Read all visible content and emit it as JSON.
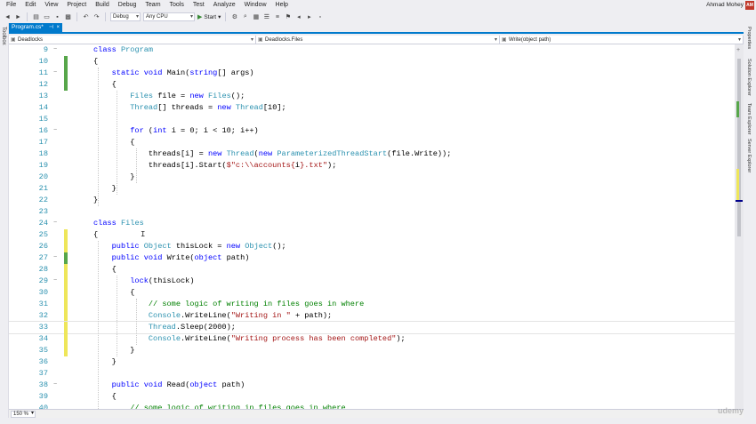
{
  "menu": [
    "File",
    "Edit",
    "View",
    "Project",
    "Build",
    "Debug",
    "Team",
    "Tools",
    "Test",
    "Analyze",
    "Window",
    "Help"
  ],
  "user": {
    "name": "Ahmad Mohey",
    "initials": "AM"
  },
  "toolbar": {
    "configuration": "Debug",
    "platform": "Any CPU",
    "start_label": "Start"
  },
  "left_tool": "Toolbox",
  "right_tabs": [
    "Properties",
    "Solution Explorer",
    "Team Explorer",
    "Server Explorer"
  ],
  "document_tab": {
    "title": "Program.cs*",
    "pin": "⊣",
    "close": "×"
  },
  "navbar": {
    "project": "Deadlocks",
    "class": "Deadlocks.Files",
    "member": "Write(object path)"
  },
  "zoom": "150 %",
  "code_lines": [
    {
      "num": "9",
      "change": "none",
      "html": "<span class=\"kw\">class</span> <span class=\"ty\">Program</span>"
    },
    {
      "num": "10",
      "change": "green",
      "html": "{"
    },
    {
      "num": "11",
      "change": "green",
      "html": "    <span class=\"kw\">static</span> <span class=\"kw\">void</span> Main(<span class=\"kw\">string</span>[] args)"
    },
    {
      "num": "12",
      "change": "green",
      "html": "    {"
    },
    {
      "num": "13",
      "change": "none",
      "html": "        <span class=\"ty\">Files</span> file = <span class=\"kw\">new</span> <span class=\"ty\">Files</span>();"
    },
    {
      "num": "14",
      "change": "none",
      "html": "        <span class=\"ty\">Thread</span>[] threads = <span class=\"kw\">new</span> <span class=\"ty\">Thread</span>[10];"
    },
    {
      "num": "15",
      "change": "none",
      "html": ""
    },
    {
      "num": "16",
      "change": "none",
      "html": "        <span class=\"kw\">for</span> (<span class=\"kw\">int</span> i = 0; i &lt; 10; i++)"
    },
    {
      "num": "17",
      "change": "none",
      "html": "        {"
    },
    {
      "num": "18",
      "change": "none",
      "html": "            threads[i] = <span class=\"kw\">new</span> <span class=\"ty\">Thread</span>(<span class=\"kw\">new</span> <span class=\"ty\">ParameterizedThreadStart</span>(file.Write));"
    },
    {
      "num": "19",
      "change": "none",
      "html": "            threads[i].Start(<span class=\"st\">$\"c:\\\\accounts{</span>i<span class=\"st\">}.txt\"</span>);"
    },
    {
      "num": "20",
      "change": "none",
      "html": "        }"
    },
    {
      "num": "21",
      "change": "none",
      "html": "    }"
    },
    {
      "num": "22",
      "change": "none",
      "html": "}"
    },
    {
      "num": "23",
      "change": "none",
      "html": ""
    },
    {
      "num": "24",
      "change": "none",
      "html": "<span class=\"kw\">class</span> <span class=\"ty\">Files</span>"
    },
    {
      "num": "25",
      "change": "yellow",
      "html": "{"
    },
    {
      "num": "26",
      "change": "yellow",
      "html": "    <span class=\"kw\">public</span> <span class=\"ty\">Object</span> thisLock = <span class=\"kw\">new</span> <span class=\"ty\">Object</span>();"
    },
    {
      "num": "27",
      "change": "green",
      "html": "    <span class=\"kw\">public</span> <span class=\"kw\">void</span> Write(<span class=\"kw\">object</span> path)"
    },
    {
      "num": "28",
      "change": "yellow",
      "html": "    {"
    },
    {
      "num": "29",
      "change": "yellow",
      "html": "        <span class=\"kw\">lock</span>(thisLock)"
    },
    {
      "num": "30",
      "change": "yellow",
      "html": "        {"
    },
    {
      "num": "31",
      "change": "yellow",
      "html": "            <span class=\"cm\">// some logic of writing in files goes in where</span>"
    },
    {
      "num": "32",
      "change": "yellow",
      "html": "            <span class=\"ty\">Console</span>.WriteLine(<span class=\"st\">\"Writing in \"</span> + path);"
    },
    {
      "num": "33",
      "change": "yellow",
      "html": "            <span class=\"ty\">Thread</span>.Sleep(2000);",
      "current": true
    },
    {
      "num": "34",
      "change": "yellow",
      "html": "            <span class=\"ty\">Console</span>.WriteLine(<span class=\"st\">\"Writing process has been completed\"</span>);"
    },
    {
      "num": "35",
      "change": "yellow",
      "html": "        }"
    },
    {
      "num": "36",
      "change": "none",
      "html": "    }"
    },
    {
      "num": "37",
      "change": "none",
      "html": ""
    },
    {
      "num": "38",
      "change": "none",
      "html": "    <span class=\"kw\">public</span> <span class=\"kw\">void</span> Read(<span class=\"kw\">object</span> path)"
    },
    {
      "num": "39",
      "change": "none",
      "html": "    {"
    },
    {
      "num": "40",
      "change": "none",
      "html": "        <span class=\"cm\">// some logic of writing in files goes in where</span>"
    }
  ],
  "watermark": "udemy"
}
